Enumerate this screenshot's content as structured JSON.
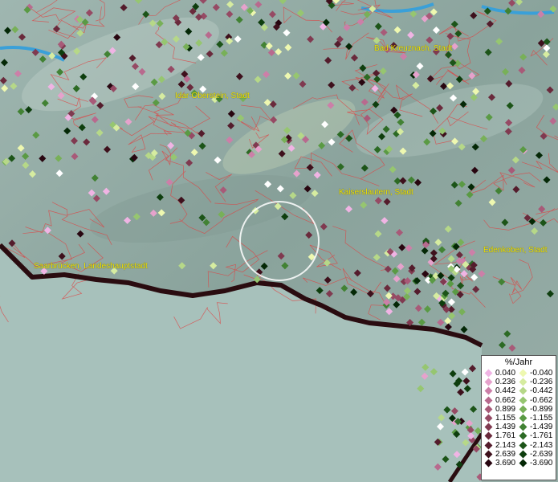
{
  "map": {
    "cities": [
      {
        "id": "bad-kreuznach",
        "name": "Bad Kreuznach, Stadt"
      },
      {
        "id": "idar-oberstein",
        "name": "Idar-Oberstein, Stadt"
      },
      {
        "id": "kaiserslautern",
        "name": "Kaiserslautern, Stadt"
      },
      {
        "id": "saarbruecken",
        "name": "Saarbrücken, Landeshauptstadt"
      },
      {
        "id": "edenkoben",
        "name": "Edenkoben, Stadt"
      }
    ],
    "colors": {
      "terrain": "#8fa8a2",
      "lowland": "#a9c2bc",
      "admin_borders": "#e04040",
      "water": "#3aa0d8",
      "city_label": "#f2e400"
    }
  },
  "legend": {
    "title": "%/Jahr",
    "positive": [
      {
        "value": "0.040",
        "color": "#f0b4e4"
      },
      {
        "value": "0.236",
        "color": "#e6a2cc"
      },
      {
        "value": "0.442",
        "color": "#cc7fa8"
      },
      {
        "value": "0.662",
        "color": "#b86a8e"
      },
      {
        "value": "0.899",
        "color": "#a85a78"
      },
      {
        "value": "1.155",
        "color": "#964a64"
      },
      {
        "value": "1.439",
        "color": "#803a50"
      },
      {
        "value": "1.761",
        "color": "#6a2a3c"
      },
      {
        "value": "2.143",
        "color": "#541c2c"
      },
      {
        "value": "2.639",
        "color": "#3e101c"
      },
      {
        "value": "3.690",
        "color": "#280610"
      }
    ],
    "negative": [
      {
        "value": "-0.040",
        "color": "#eef8b0"
      },
      {
        "value": "-0.236",
        "color": "#d6eca0"
      },
      {
        "value": "-0.442",
        "color": "#b6d888"
      },
      {
        "value": "-0.662",
        "color": "#96c670"
      },
      {
        "value": "-0.899",
        "color": "#78b058"
      },
      {
        "value": "-1.155",
        "color": "#5a9a44"
      },
      {
        "value": "-1.439",
        "color": "#428234"
      },
      {
        "value": "-1.761",
        "color": "#2c6a24"
      },
      {
        "value": "-2.143",
        "color": "#1c5418"
      },
      {
        "value": "-2.639",
        "color": "#0e3e0e"
      },
      {
        "value": "-3.690",
        "color": "#042806"
      }
    ]
  }
}
